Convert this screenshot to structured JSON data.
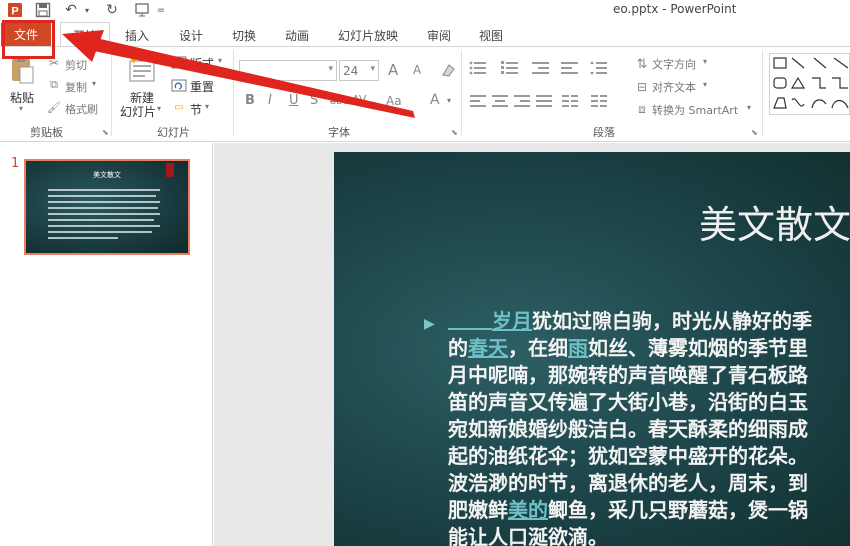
{
  "window": {
    "title": "eo.pptx - PowerPoint"
  },
  "tabs": [
    "文件",
    "开始",
    "插入",
    "设计",
    "切换",
    "动画",
    "幻灯片放映",
    "审阅",
    "视图"
  ],
  "ribbon": {
    "clipboard": {
      "label": "剪贴板",
      "paste": "粘贴",
      "cut": "剪切",
      "copy": "复制",
      "format_painter": "格式刷"
    },
    "slides": {
      "label": "幻灯片",
      "new_slide_line1": "新建",
      "new_slide_line2": "幻灯片",
      "layout": "版式",
      "reset": "重置",
      "section": "节"
    },
    "font": {
      "label": "字体",
      "font_name": "",
      "font_size": "24",
      "bold": "B",
      "italic": "I",
      "underline": "U",
      "shadow": "S",
      "strike": "abc",
      "spacing": "AV",
      "case": "Aa",
      "color": "A",
      "grow": "A",
      "shrink": "A"
    },
    "paragraph": {
      "label": "段落",
      "text_direction": "文字方向",
      "align_text": "对齐文本",
      "smartart": "转换为 SmartArt"
    }
  },
  "thumbnail": {
    "number": "1",
    "title": "美文散文"
  },
  "slide": {
    "title": "美文散文",
    "lines": [
      [
        "",
        "岁月",
        "犹如过隙白驹，时光从静好的季"
      ],
      [
        "的",
        "春天",
        "，在细",
        "雨",
        "如丝、薄雾如烟的季节里"
      ],
      [
        "月中呢喃，那婉转的声音唤醒了青石板路"
      ],
      [
        "笛的声音又传遍了大街小巷，沿街的白玉"
      ],
      [
        "宛如新娘婚纱般洁白。春天酥柔的细雨成"
      ],
      [
        "起的油纸花伞；犹如空蒙中盛开的花朵。"
      ],
      [
        "波浩渺的时节，离退休的老人，周末，到"
      ],
      [
        "肥嫩鲜",
        "美的",
        "鲫鱼，采几只野蘑菇，煲一锅"
      ],
      [
        "能让人口涎欲滴。"
      ]
    ]
  },
  "colors": {
    "accent": "#d24726",
    "annotation": "#e0251f",
    "slide_bg": "#1c4449",
    "link_text": "#6ec0c6"
  }
}
